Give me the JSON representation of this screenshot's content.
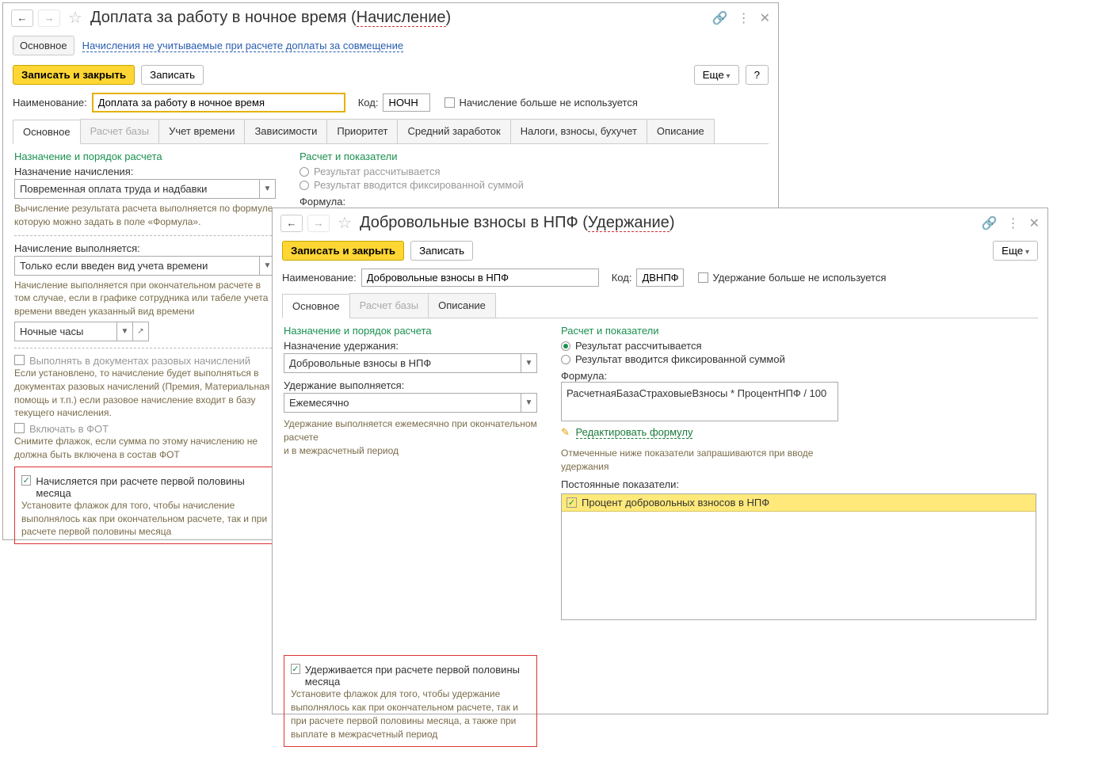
{
  "win1": {
    "title_main": "Доплата за работу в ночное время (",
    "title_accent": "Начисление",
    "title_close": ")",
    "nav_active": "Основное",
    "nav_link": "Начисления не учитываемые при расчете доплаты за совмещение",
    "btn_save_close": "Записать и закрыть",
    "btn_save": "Записать",
    "btn_more": "Еще",
    "btn_help": "?",
    "lbl_name": "Наименование:",
    "val_name": "Доплата за работу в ночное время",
    "lbl_code": "Код:",
    "val_code": "НОЧН",
    "cb_unused_label": "Начисление больше не используется",
    "tabs": [
      "Основное",
      "Расчет базы",
      "Учет времени",
      "Зависимости",
      "Приоритет",
      "Средний заработок",
      "Налоги, взносы, бухучет",
      "Описание"
    ],
    "sec_assign": "Назначение и порядок расчета",
    "lbl_assign": "Назначение начисления:",
    "val_assign": "Повременная оплата труда и надбавки",
    "hint_formula": "Вычисление результата расчета выполняется по формуле, которую можно задать в поле «Формула».",
    "lbl_when": "Начисление выполняется:",
    "val_when": "Только если введен вид учета времени",
    "hint_when": "Начисление выполняется при окончательном расчете в том случае, если в графике сотрудника или табеле учета времени введен указанный вид времени",
    "val_time_kind": "Ночные часы",
    "cb_once_docs": "Выполнять в документах разовых начислений",
    "hint_once": "Если установлено, то начисление будет выполняться в документах разовых начислений (Премия, Материальная помощь и т.п.) если разовое начисление входит в базу текущего начисления.",
    "cb_fot": "Включать в ФОТ",
    "hint_fot": "Снимите флажок, если сумма по этому начислению не должна быть включена в состав ФОТ",
    "cb_half_month": "Начисляется при расчете первой половины месяца",
    "hint_half": "Установите флажок для того, чтобы начисление выполнялось как при окончательном расчете, так и при расчете первой половины месяца",
    "sec_calc": "Расчет и показатели",
    "radio_calc": "Результат рассчитывается",
    "radio_fixed": "Результат вводится фиксированной суммой",
    "lbl_formula": "Формула:"
  },
  "win2": {
    "title_main": "Добровольные взносы в НПФ (",
    "title_accent": "Удержание",
    "title_close": ")",
    "btn_save_close": "Записать и закрыть",
    "btn_save": "Записать",
    "btn_more": "Еще",
    "lbl_name": "Наименование:",
    "val_name": "Добровольные взносы в НПФ",
    "lbl_code": "Код:",
    "val_code": "ДВНПФ",
    "cb_unused_label": "Удержание больше не используется",
    "tabs": [
      "Основное",
      "Расчет базы",
      "Описание"
    ],
    "sec_assign": "Назначение и порядок расчета",
    "lbl_assign": "Назначение удержания:",
    "val_assign": "Добровольные взносы в НПФ",
    "lbl_when": "Удержание выполняется:",
    "val_when": "Ежемесячно",
    "hint_when": "Удержание выполняется ежемесячно при окончательном расчете\nи в межрасчетный период",
    "cb_half_month": "Удерживается при расчете первой половины месяца",
    "hint_half": "Установите флажок для того, чтобы удержание выполнялось как при окончательном расчете, так и при расчете первой половины месяца, а также при выплате в межрасчетный период",
    "sec_calc": "Расчет и показатели",
    "radio_calc": "Результат рассчитывается",
    "radio_fixed": "Результат вводится фиксированной суммой",
    "lbl_formula": "Формула:",
    "val_formula": "РасчетнаяБазаСтраховыеВзносы * ПроцентНПФ / 100",
    "edit_formula": "Редактировать формулу",
    "hint_params": "Отмеченные ниже показатели запрашиваются при вводе удержания",
    "lbl_const_params": "Постоянные показатели:",
    "param1": "Процент добровольных взносов в НПФ"
  }
}
